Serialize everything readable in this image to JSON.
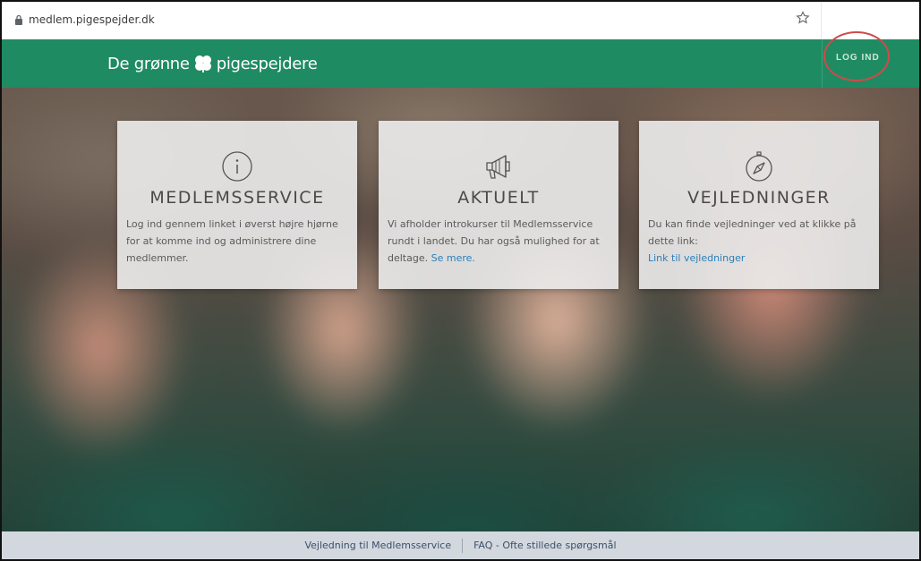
{
  "browser": {
    "url": "medlem.pigespejder.dk"
  },
  "header": {
    "logo_left": "De grønne",
    "logo_right": "pigespejdere",
    "login_label": "LOG IND"
  },
  "cards": [
    {
      "icon": "info-icon",
      "title": "MEDLEMSSERVICE",
      "text": "Log ind gennem linket i øverst højre hjørne for at komme ind og administrere dine medlemmer.",
      "link": ""
    },
    {
      "icon": "megaphone-icon",
      "title": "AKTUELT",
      "text": "Vi afholder introkurser til Medlemsservice rundt i landet. Du har også mulighed for at deltage. ",
      "link": "Se mere."
    },
    {
      "icon": "compass-icon",
      "title": "VEJLEDNINGER",
      "text": "Du kan finde vejledninger ved at klikke på dette link:",
      "link": "Link til vejledninger"
    }
  ],
  "footer": {
    "links": [
      "Vejledning til Medlemsservice",
      "FAQ - Ofte stillede spørgsmål"
    ]
  },
  "colors": {
    "header_green": "#1f8b63",
    "link_blue": "#2a7fb8",
    "highlight_red": "#d04a4a"
  }
}
